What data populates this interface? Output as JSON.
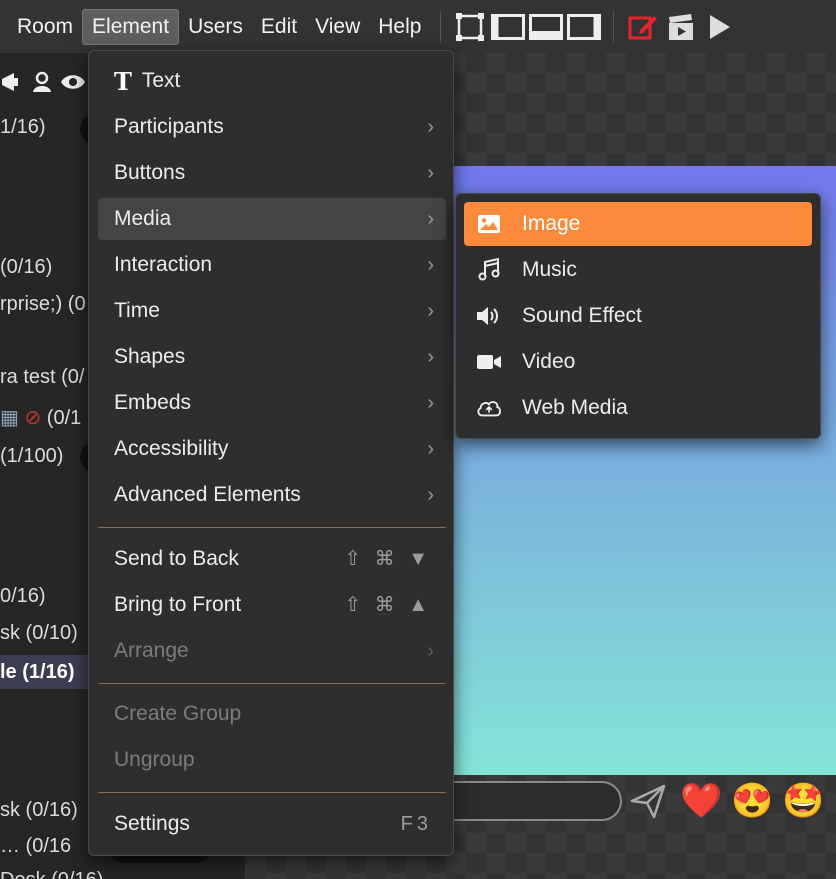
{
  "menubar": {
    "items": [
      {
        "label": "Room"
      },
      {
        "label": "Element"
      },
      {
        "label": "Users"
      },
      {
        "label": "Edit"
      },
      {
        "label": "View"
      },
      {
        "label": "Help"
      }
    ]
  },
  "sidebar": {
    "rows": [
      {
        "text": "1/16)"
      },
      {
        "text": "(0/16)"
      },
      {
        "text": "rprise;) (0"
      },
      {
        "text": "ra test (0/"
      },
      {
        "text": "(0/1"
      },
      {
        "text": "(1/100)"
      },
      {
        "text": "0/16)"
      },
      {
        "text": "sk (0/10)"
      },
      {
        "text": "le (1/16)"
      },
      {
        "text": "sk (0/16)"
      },
      {
        "text": "…   (0/16"
      },
      {
        "text": "Desk (0/16)"
      }
    ]
  },
  "element_menu": {
    "text_item": "Text",
    "items": [
      {
        "label": "Participants",
        "chev": "›"
      },
      {
        "label": "Buttons",
        "chev": "›"
      },
      {
        "label": "Media",
        "chev": "›"
      },
      {
        "label": "Interaction",
        "chev": "›"
      },
      {
        "label": "Time",
        "chev": "›"
      },
      {
        "label": "Shapes",
        "chev": "›"
      },
      {
        "label": "Embeds",
        "chev": "›"
      },
      {
        "label": "Accessibility",
        "chev": "›"
      },
      {
        "label": "Advanced Elements",
        "chev": "›"
      }
    ],
    "send_to_back": {
      "label": "Send to Back",
      "shortcut": "⇧ ⌘ ▼"
    },
    "bring_to_front": {
      "label": "Bring to Front",
      "shortcut": "⇧ ⌘ ▲"
    },
    "arrange": {
      "label": "Arrange",
      "chev": "›"
    },
    "create_group": "Create Group",
    "ungroup": "Ungroup",
    "settings": {
      "label": "Settings",
      "shortcut": "F3"
    }
  },
  "media_submenu": {
    "items": [
      {
        "label": "Image",
        "icon": "image-icon"
      },
      {
        "label": "Music",
        "icon": "music-icon"
      },
      {
        "label": "Sound Effect",
        "icon": "speaker-icon"
      },
      {
        "label": "Video",
        "icon": "video-camera-icon"
      },
      {
        "label": "Web Media",
        "icon": "cloud-icon"
      }
    ]
  },
  "chat": {
    "emojis": [
      "❤️",
      "😍",
      "🤩"
    ]
  },
  "colors": {
    "accent": "#fd8a3c",
    "menu_bg": "#2e2e2e",
    "edit_icon_red": "#e2262c"
  }
}
